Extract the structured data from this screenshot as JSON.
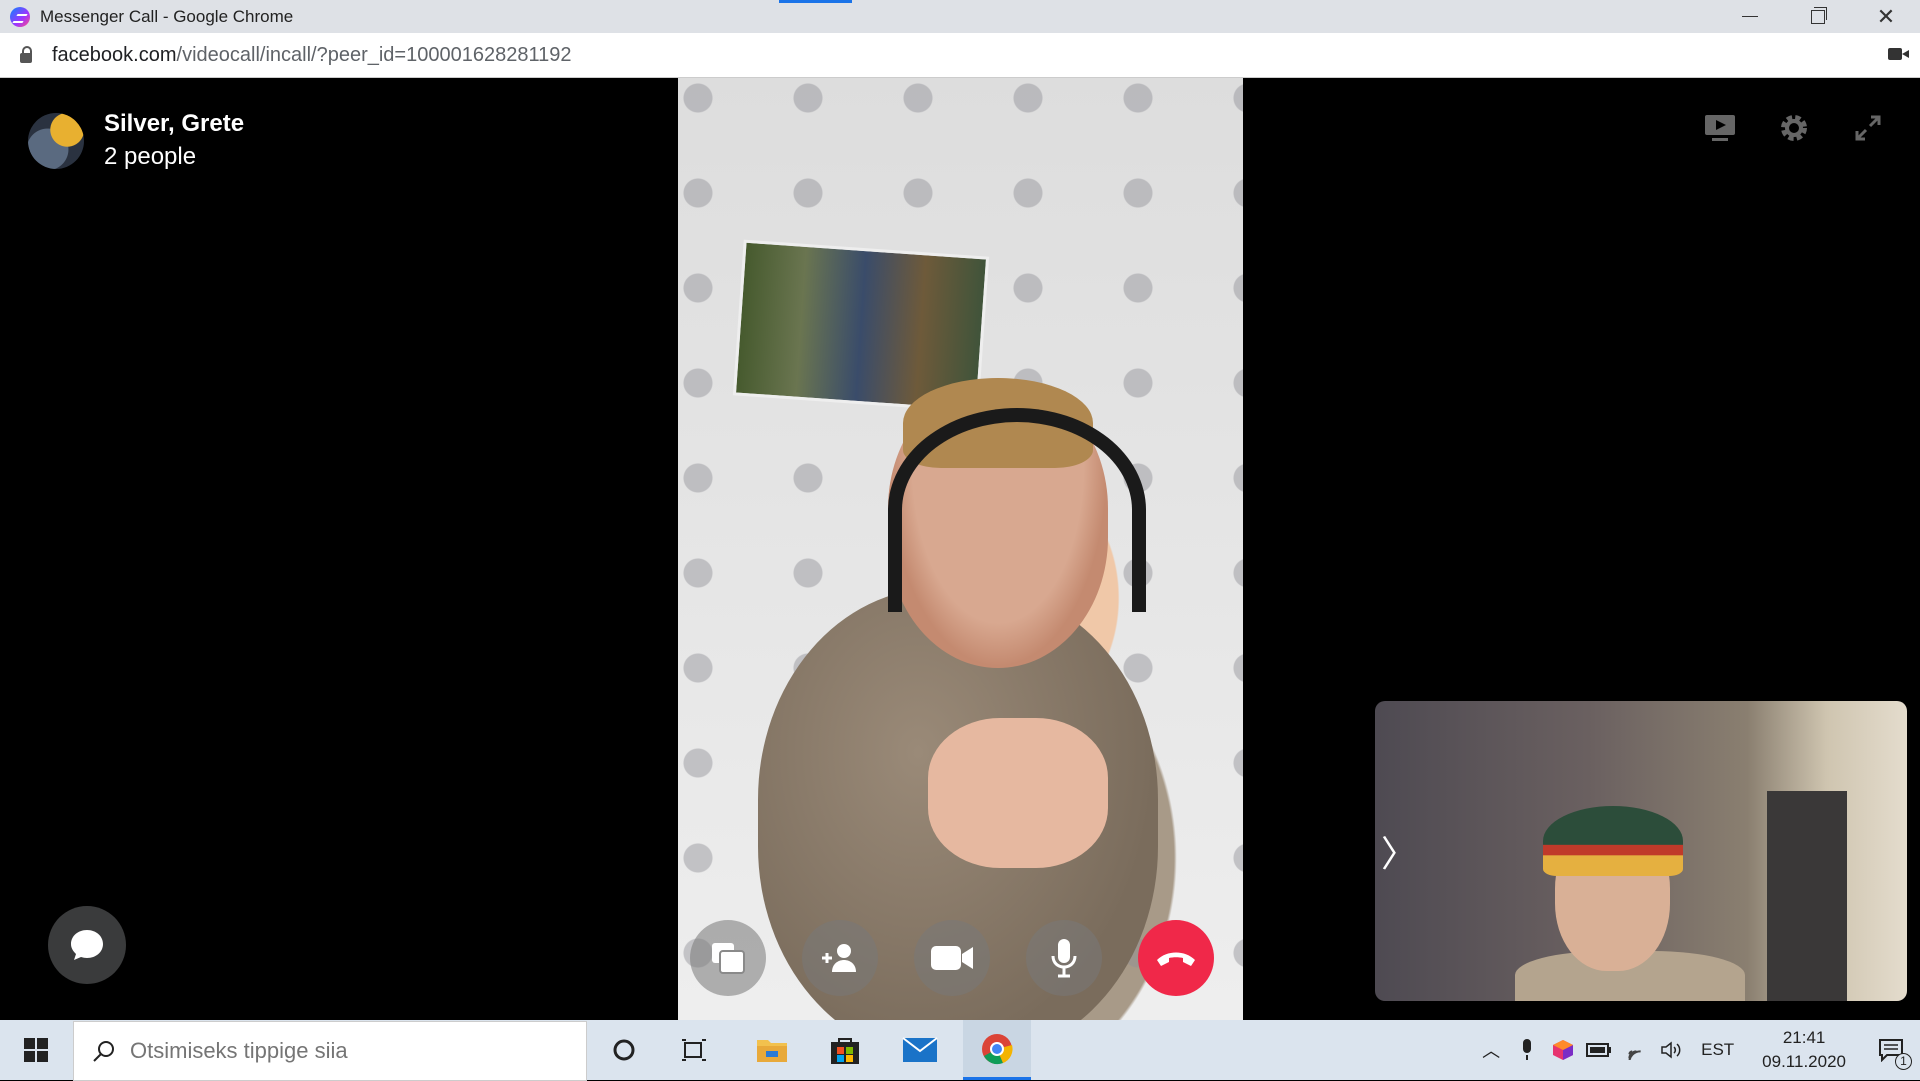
{
  "browser": {
    "tab_title": "Messenger Call - Google Chrome",
    "url_host": "facebook.com",
    "url_path": "/videocall/incall/?peer_id=100001628281192"
  },
  "call": {
    "peer_name": "Silver, Grete",
    "participants": "2 people",
    "top_icons": [
      "screen-share-icon",
      "settings-icon",
      "fullscreen-icon"
    ],
    "controls": [
      "share-screen",
      "add-person",
      "camera",
      "microphone",
      "end-call"
    ],
    "end_call_color": "#f02849"
  },
  "taskbar": {
    "search_placeholder": "Otsimiseks tippige siia",
    "language": "EST",
    "time": "21:41",
    "date": "09.11.2020",
    "notification_count": "1",
    "pinned": [
      "cortana",
      "task-view",
      "file-explorer",
      "microsoft-store",
      "mail",
      "chrome"
    ]
  }
}
